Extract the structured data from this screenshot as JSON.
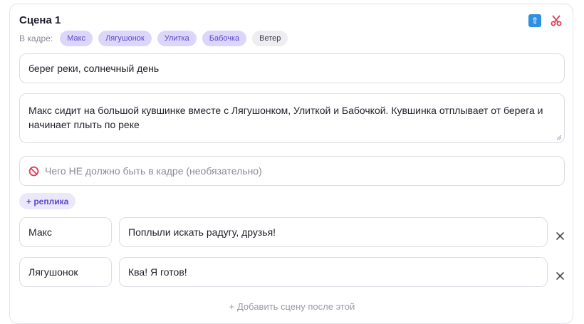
{
  "scene": {
    "title": "Сцена 1",
    "characters_label": "В кадре:",
    "characters": [
      {
        "name": "Макс",
        "selected": true
      },
      {
        "name": "Лягушонок",
        "selected": true
      },
      {
        "name": "Улитка",
        "selected": true
      },
      {
        "name": "Бабочка",
        "selected": true
      },
      {
        "name": "Ветер",
        "selected": false
      }
    ],
    "setting": "берег реки, солнечный день",
    "description": "Макс сидит на большой кувшинке вместе с Лягушонком, Улиткой и Бабочкой. Кувшинка отплывает от берега и начинает плыть по реке",
    "negative_placeholder": "Чего НЕ должно быть в кадре (необязательно)",
    "add_line_label": "+ реплика",
    "dialogue": [
      {
        "speaker": "Макс",
        "text": "Поплыли искать радугу, друзья!"
      },
      {
        "speaker": "Лягушонок",
        "text": "Ква! Я готов!"
      }
    ],
    "add_scene_label": "+ Добавить сцену после этой"
  },
  "icons": {
    "move_up": "arrow-up-icon",
    "split": "scissors-icon",
    "no_entry": "no-entry-icon",
    "remove": "close-icon"
  },
  "colors": {
    "chip_selected_bg": "#ddd6fb",
    "chip_selected_text": "#5b48c8",
    "chip_unselected_bg": "#eeeef2",
    "accent": "#5b48c8",
    "up_icon": "#2f8fe0",
    "scissors": "#e0405a",
    "no_entry": "#e0405a"
  }
}
